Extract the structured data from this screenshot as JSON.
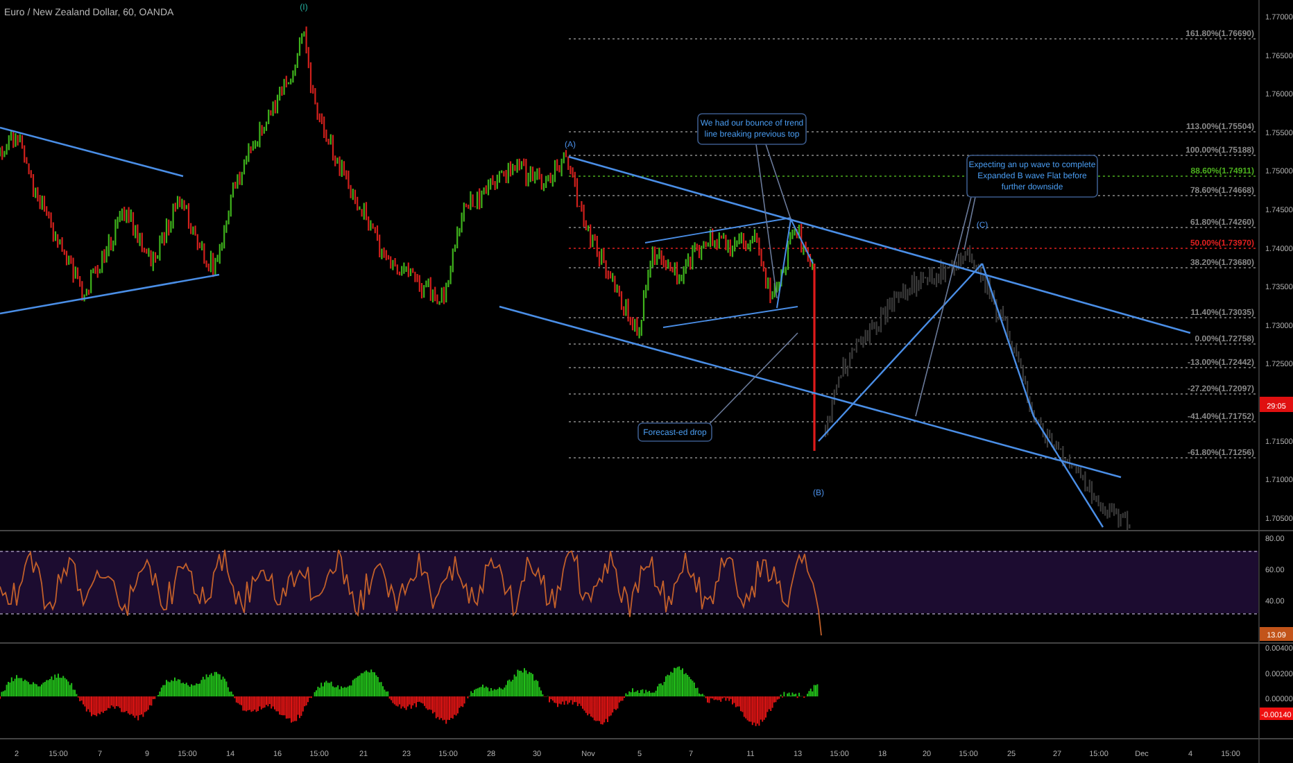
{
  "chart_title": "Euro / New Zealand Dollar, 60, OANDA",
  "wave_labels": [
    "(I)",
    "(A)",
    "(B)",
    "(C)"
  ],
  "annotations": [
    {
      "lines": [
        "We had our bounce of trend",
        "line breaking previous top"
      ]
    },
    {
      "lines": [
        "Expecting an up wave to complete",
        "Expanded B wave Flat before",
        "further downside"
      ]
    },
    {
      "lines": [
        "Forecast-ed drop"
      ]
    }
  ],
  "fib_levels": [
    {
      "label": "161.80%(1.76690)",
      "color": "#8a8a8a"
    },
    {
      "label": "113.00%(1.75504)",
      "color": "#8a8a8a"
    },
    {
      "label": "100.00%(1.75188)",
      "color": "#8a8a8a"
    },
    {
      "label": "88.60%(1.74911)",
      "color": "#4caf1e"
    },
    {
      "label": "78.60%(1.74668)",
      "color": "#8a8a8a"
    },
    {
      "label": "61.80%(1.74260)",
      "color": "#8a8a8a"
    },
    {
      "label": "50.00%(1.73970)",
      "color": "#e02020"
    },
    {
      "label": "38.20%(1.73680)",
      "color": "#8a8a8a"
    },
    {
      "label": "11.40%(1.73035)",
      "color": "#8a8a8a"
    },
    {
      "label": "0.00%(1.72758)",
      "color": "#8a8a8a"
    },
    {
      "label": "-13.00%(1.72442)",
      "color": "#8a8a8a"
    },
    {
      "label": "-27.20%(1.72097)",
      "color": "#8a8a8a"
    },
    {
      "label": "-41.40%(1.71752)",
      "color": "#8a8a8a"
    },
    {
      "label": "-61.80%(1.71256)",
      "color": "#8a8a8a"
    }
  ],
  "price_axis": [
    "1.77000",
    "1.76500",
    "1.76000",
    "1.75500",
    "1.75000",
    "1.74500",
    "1.74000",
    "1.73500",
    "1.73000",
    "1.72500",
    "1.71500",
    "1.71000",
    "1.70500"
  ],
  "price_badge": "29:05",
  "rsi_pane": {
    "axis": [
      "80.00",
      "60.00",
      "40.00"
    ],
    "badge": "13.09"
  },
  "oscillator_pane": {
    "axis": [
      "0.00400",
      "0.00200",
      "0.00000"
    ],
    "badge": "-0.00140"
  },
  "time_axis": [
    "2",
    "15:00",
    "7",
    "9",
    "15:00",
    "14",
    "16",
    "15:00",
    "21",
    "23",
    "15:00",
    "28",
    "30",
    "Nov",
    "5",
    "7",
    "11",
    "13",
    "15:00",
    "18",
    "20",
    "15:00",
    "25",
    "27",
    "15:00",
    "Dec",
    "4",
    "15:00"
  ]
}
